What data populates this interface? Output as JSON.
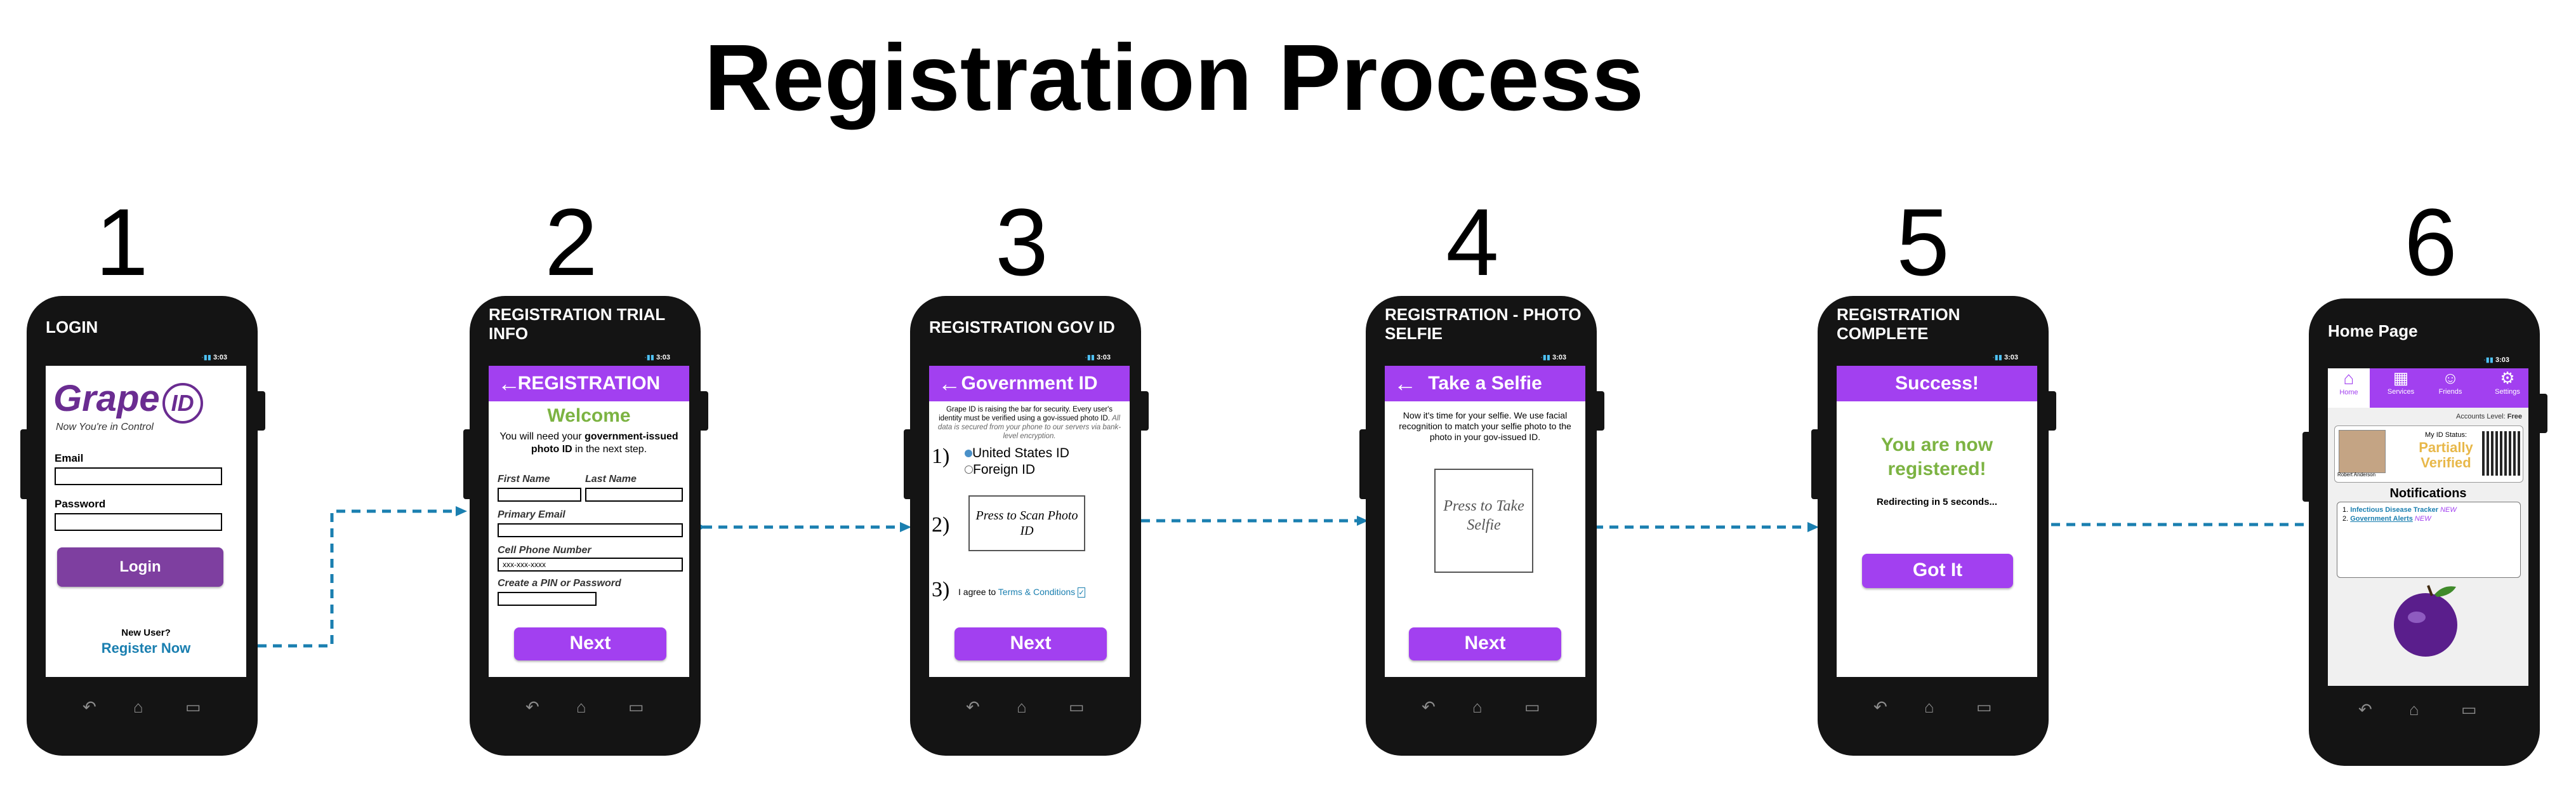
{
  "title": "Registration Process",
  "steps": [
    "1",
    "2",
    "3",
    "4",
    "5",
    "6"
  ],
  "status": {
    "icons": "·▮▮",
    "time": "3:03"
  },
  "nav_icons": {
    "back": "↶",
    "home": "⌂",
    "recent": "▭"
  },
  "login": {
    "header": "LOGIN",
    "logo": "Grape",
    "logo_id": "ID",
    "tagline": "Now You're in Control",
    "email_label": "Email",
    "password_label": "Password",
    "login_button": "Login",
    "new_user": "New User?",
    "register_link": "Register Now"
  },
  "trial": {
    "header": "REGISTRATION TRIAL INFO",
    "appbar": "REGISTRATION",
    "welcome": "Welcome",
    "intro_1": "You will need your",
    "intro_bold": "government-issued photo ID",
    "intro_2": "in the next step.",
    "first_name": "First Name",
    "last_name": "Last Name",
    "email": "Primary Email",
    "phone": "Cell Phone Number",
    "phone_placeholder": "xxx-xxx-xxxx",
    "pin": "Create a PIN or Password",
    "next": "Next"
  },
  "govid": {
    "header": "REGISTRATION GOV ID",
    "appbar": "Government ID",
    "intro": "Grape ID is raising the bar for security. Every user's identity must be verified using a gov-issued photo ID.",
    "intro_italic": "All data is secured from your phone to our servers via bank-level encryption.",
    "n1": "1)",
    "opt1": "United States ID",
    "opt2": "Foreign ID",
    "n2": "2)",
    "scan": "Press to Scan Photo ID",
    "n3": "3)",
    "agree": "I agree to",
    "terms": "Terms & Conditions",
    "next": "Next"
  },
  "selfie": {
    "header": "REGISTRATION - PHOTO SELFIE",
    "appbar": "Take a Selfie",
    "intro": "Now it's time for your selfie. We use facial recognition to match your selfie photo to the photo in your gov-issued ID.",
    "take": "Press to Take Selfie",
    "next": "Next"
  },
  "complete": {
    "header": "REGISTRATION COMPLETE",
    "appbar": "Success!",
    "registered": "You are now registered!",
    "redirect": "Redirecting in 5 seconds...",
    "gotit": "Got It"
  },
  "home": {
    "header": "Home Page",
    "tabs": [
      "Home",
      "Services",
      "Friends",
      "Settings"
    ],
    "accounts_level": "Accounts Level:",
    "accounts_value": "Free",
    "id_status_label": "My ID Status:",
    "id_status": "Partially Verified",
    "user_name": "Robert Anderson",
    "notifications": "Notifications",
    "notif_1": "Infectious Disease Tracker",
    "notif_2": "Government Alerts",
    "new_tag": "NEW"
  },
  "colors": {
    "purple": "#a240f0",
    "green": "#7cb342",
    "arrow": "#1a7fb0",
    "gold": "#e8b84a"
  }
}
